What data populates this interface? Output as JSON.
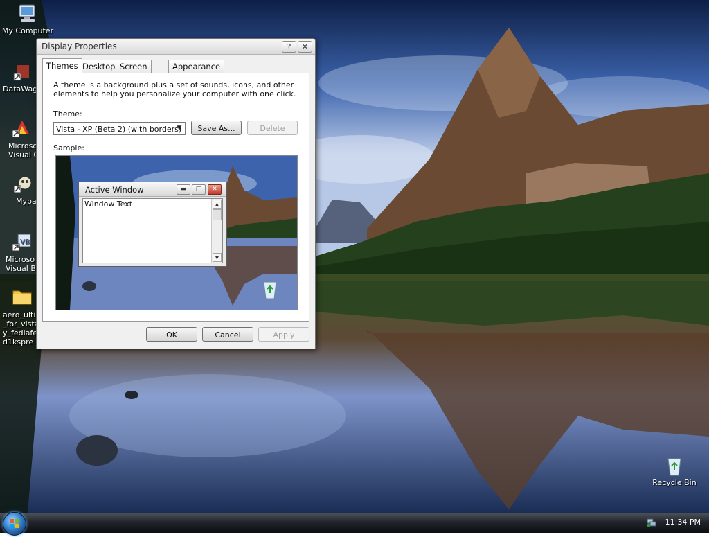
{
  "desktop": {
    "icons": [
      {
        "label": "My Computer"
      },
      {
        "label": "DataWag"
      },
      {
        "label": "Microso\nVisual C"
      },
      {
        "label": "Mypa"
      },
      {
        "label": "Microso\nVisual Ba"
      },
      {
        "label": "aero_ultim\n_for_vista\ny_fediafe\nd1kspre"
      },
      {
        "label": "Recycle Bin"
      }
    ]
  },
  "dialog": {
    "title": "Display Properties",
    "help_button": "?",
    "close_button": "✕",
    "tabs": [
      {
        "label": "Themes",
        "active": true
      },
      {
        "label": "Desktop"
      },
      {
        "label": "Screen Saver"
      },
      {
        "label": "Appearance"
      }
    ],
    "description": "A theme is a background plus a set of sounds, icons, and other elements to help you personalize your computer with one click.",
    "theme_label": "Theme:",
    "theme_value": "Vista - XP (Beta 2) (with borders)",
    "save_as_label": "Save As...",
    "delete_label": "Delete",
    "sample_label": "Sample:",
    "sample": {
      "window_title": "Active Window",
      "window_text": "Window Text"
    },
    "ok_label": "OK",
    "cancel_label": "Cancel",
    "apply_label": "Apply"
  },
  "taskbar": {
    "clock": "11:34 PM"
  },
  "colors": {
    "dialog_bg": "#f0f0f0",
    "taskbar": "#20242a",
    "start_orb": "#3c8ad6"
  }
}
